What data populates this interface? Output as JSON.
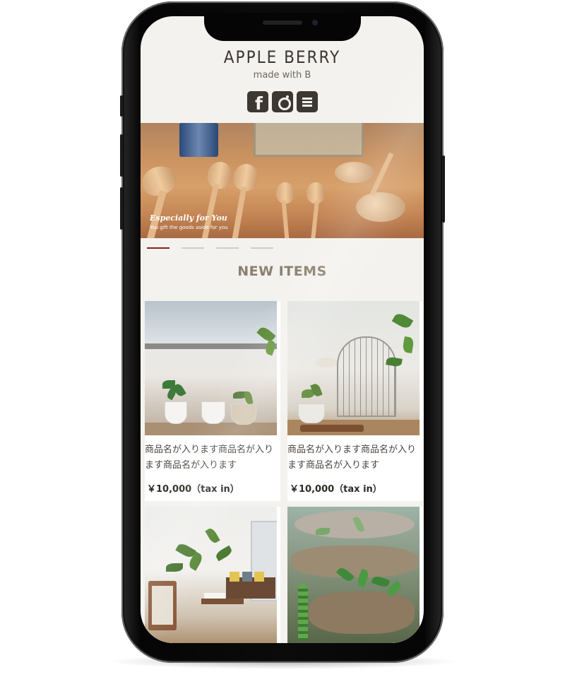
{
  "header": {
    "brand": "APPLE BERRY",
    "tagline": "made with B",
    "social": [
      {
        "name": "facebook-icon"
      },
      {
        "name": "instagram-icon"
      },
      {
        "name": "menu-icon"
      }
    ]
  },
  "hero": {
    "title": "Especially for You",
    "subtitle": "You gift the goods aside for you"
  },
  "carousel": {
    "slides": 4,
    "active_index": 0
  },
  "section": {
    "title": "NEW ITEMS"
  },
  "products": [
    {
      "name": "商品名が入ります商品名が入ります商品名が入ります",
      "price": "￥10,000（tax in）"
    },
    {
      "name": "商品名が入ります商品名が入ります商品名が入ります",
      "price": "￥10,000（tax in）"
    },
    {
      "name": "",
      "price": ""
    },
    {
      "name": "",
      "price": ""
    }
  ],
  "colors": {
    "background": "#f4f2ee",
    "brand_text": "#3b3632",
    "section_title": "#8b8070",
    "active_dot": "#8a1f22",
    "inactive_dot": "#d0ccc6"
  }
}
